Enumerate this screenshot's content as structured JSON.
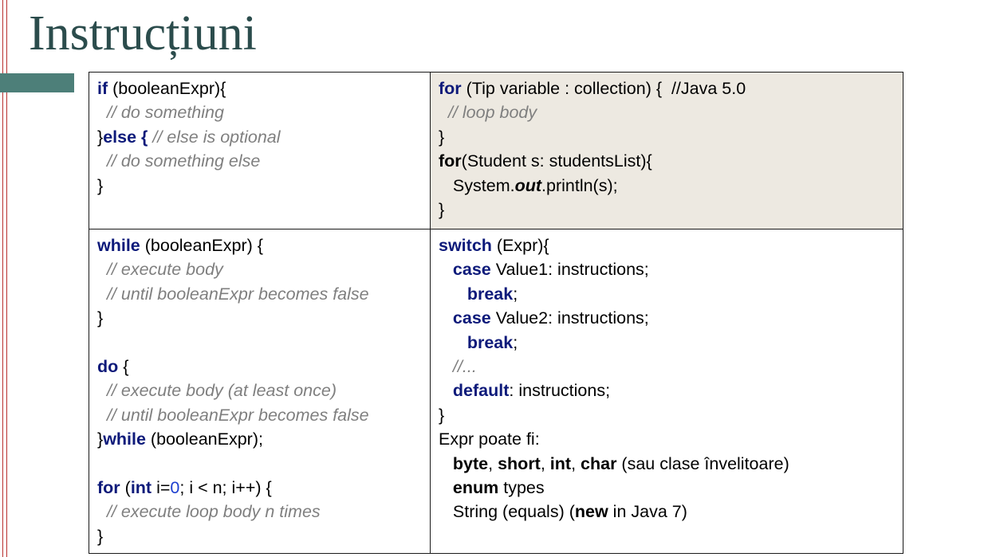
{
  "title": "Instrucțiuni",
  "colors": {
    "title": "#2b4c4c",
    "accent_bar": "#4d7f79",
    "margin_line": "#b8312f",
    "keyword": "#0d1a7a",
    "comment": "#7f7f7f",
    "number": "#1e3fd0",
    "shaded_cell": "#ede9e1"
  },
  "cells": {
    "if_else": {
      "lines": [
        [
          {
            "t": "if",
            "s": "kw"
          },
          {
            "t": " (booleanExpr){"
          }
        ],
        [
          {
            "t": "  "
          },
          {
            "t": "// do something",
            "s": "cm"
          }
        ],
        [
          {
            "t": "}"
          },
          {
            "t": "else {",
            "s": "kw"
          },
          {
            "t": " "
          },
          {
            "t": "// else is optional",
            "s": "cm"
          }
        ],
        [
          {
            "t": "  "
          },
          {
            "t": "// do something else",
            "s": "cm"
          }
        ],
        [
          {
            "t": "}"
          }
        ]
      ]
    },
    "for_each": {
      "lines": [
        [
          {
            "t": "for",
            "s": "kw"
          },
          {
            "t": " (Tip variable : collection) {  //Java 5.0"
          }
        ],
        [
          {
            "t": "  "
          },
          {
            "t": "// loop body",
            "s": "cm"
          }
        ],
        [
          {
            "t": "}"
          }
        ],
        [
          {
            "t": "for",
            "s": "b"
          },
          {
            "t": "(Student s: studentsList){"
          }
        ],
        [
          {
            "t": "   System."
          },
          {
            "t": "out",
            "s": "bi"
          },
          {
            "t": ".println(s);"
          }
        ],
        [
          {
            "t": "}"
          }
        ]
      ]
    },
    "loops": {
      "lines": [
        [
          {
            "t": "while",
            "s": "kw"
          },
          {
            "t": " (booleanExpr) {"
          }
        ],
        [
          {
            "t": "  "
          },
          {
            "t": "// execute body",
            "s": "cm"
          }
        ],
        [
          {
            "t": "  "
          },
          {
            "t": "// until booleanExpr becomes false",
            "s": "cm"
          }
        ],
        [
          {
            "t": "}"
          }
        ],
        [],
        [
          {
            "t": "do",
            "s": "kw"
          },
          {
            "t": " {"
          }
        ],
        [
          {
            "t": "  "
          },
          {
            "t": "// execute body (at least once)",
            "s": "cm"
          }
        ],
        [
          {
            "t": "  "
          },
          {
            "t": "// until booleanExpr becomes false",
            "s": "cm"
          }
        ],
        [
          {
            "t": "}"
          },
          {
            "t": "while",
            "s": "kw"
          },
          {
            "t": " (booleanExpr);"
          }
        ],
        [],
        [
          {
            "t": "for",
            "s": "kw"
          },
          {
            "t": " ("
          },
          {
            "t": "int",
            "s": "kw"
          },
          {
            "t": " i="
          },
          {
            "t": "0",
            "s": "num"
          },
          {
            "t": "; i < n; i++) {"
          }
        ],
        [
          {
            "t": "  "
          },
          {
            "t": "// execute loop body n times",
            "s": "cm"
          }
        ],
        [
          {
            "t": "}"
          }
        ]
      ]
    },
    "switch": {
      "lines": [
        [
          {
            "t": "switch",
            "s": "kw"
          },
          {
            "t": " (Expr){"
          }
        ],
        [
          {
            "t": "   "
          },
          {
            "t": "case",
            "s": "kw"
          },
          {
            "t": " Value1: instructions;"
          }
        ],
        [
          {
            "t": "      "
          },
          {
            "t": "break",
            "s": "kw"
          },
          {
            "t": ";"
          }
        ],
        [
          {
            "t": "   "
          },
          {
            "t": "case",
            "s": "kw"
          },
          {
            "t": " Value2: instructions;"
          }
        ],
        [
          {
            "t": "      "
          },
          {
            "t": "break",
            "s": "kw"
          },
          {
            "t": ";"
          }
        ],
        [
          {
            "t": "   "
          },
          {
            "t": "//...",
            "s": "cm"
          }
        ],
        [
          {
            "t": "   "
          },
          {
            "t": "default",
            "s": "kw"
          },
          {
            "t": ": instructions;"
          }
        ],
        [
          {
            "t": "}"
          }
        ],
        [
          {
            "t": "Expr poate fi:"
          }
        ],
        [
          {
            "t": "   "
          },
          {
            "t": "byte",
            "s": "b"
          },
          {
            "t": ", "
          },
          {
            "t": "short",
            "s": "b"
          },
          {
            "t": ", "
          },
          {
            "t": "int",
            "s": "b"
          },
          {
            "t": ", "
          },
          {
            "t": "char",
            "s": "b"
          },
          {
            "t": " (sau clase învelitoare)"
          }
        ],
        [
          {
            "t": "   "
          },
          {
            "t": "enum",
            "s": "b"
          },
          {
            "t": " types"
          }
        ],
        [
          {
            "t": "   String (equals) ("
          },
          {
            "t": "new",
            "s": "b"
          },
          {
            "t": " in Java 7)"
          }
        ]
      ]
    }
  }
}
